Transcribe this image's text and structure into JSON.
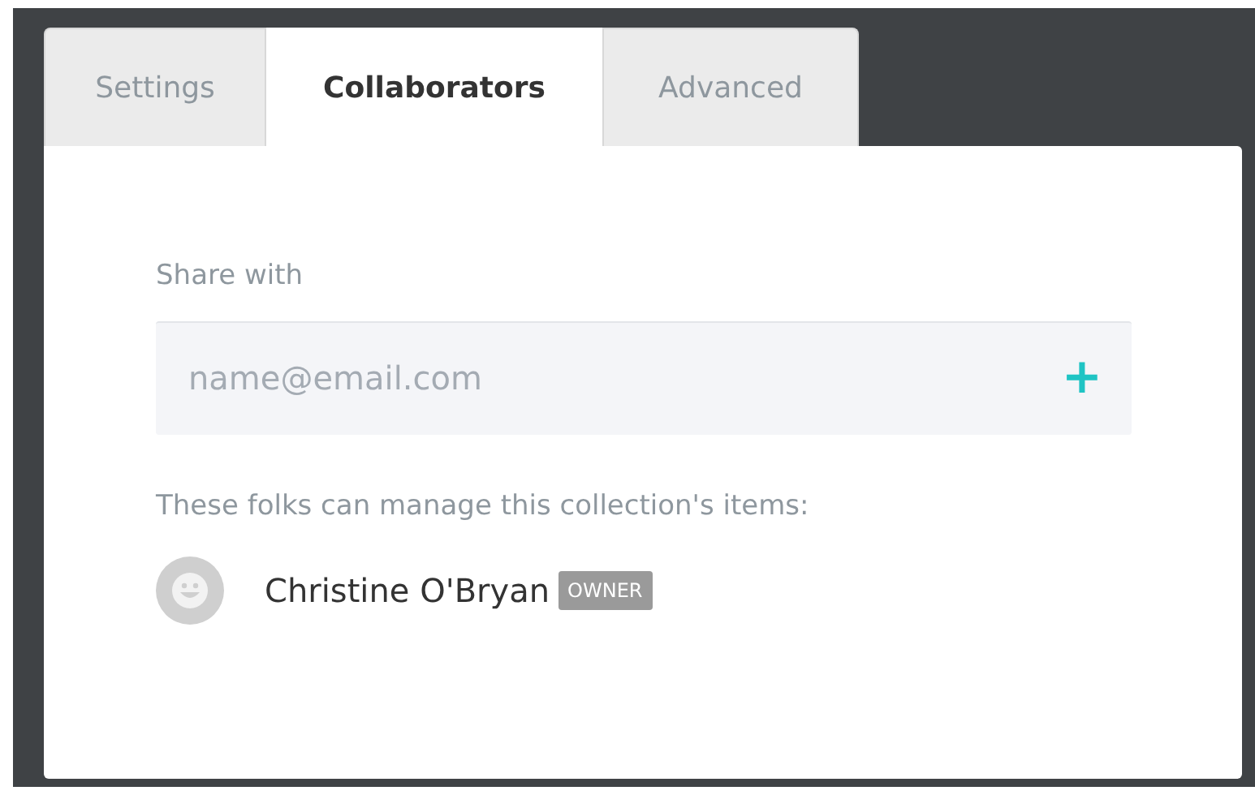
{
  "tabs": [
    {
      "label": "Settings",
      "selected": false
    },
    {
      "label": "Collaborators",
      "selected": true
    },
    {
      "label": "Advanced",
      "selected": false
    }
  ],
  "share": {
    "label": "Share with",
    "placeholder": "name@email.com",
    "add_icon": "+"
  },
  "collaborators": {
    "label": "These folks can manage this collection's items:",
    "people": [
      {
        "name": "Christine O'Bryan",
        "role": "OWNER"
      }
    ]
  }
}
